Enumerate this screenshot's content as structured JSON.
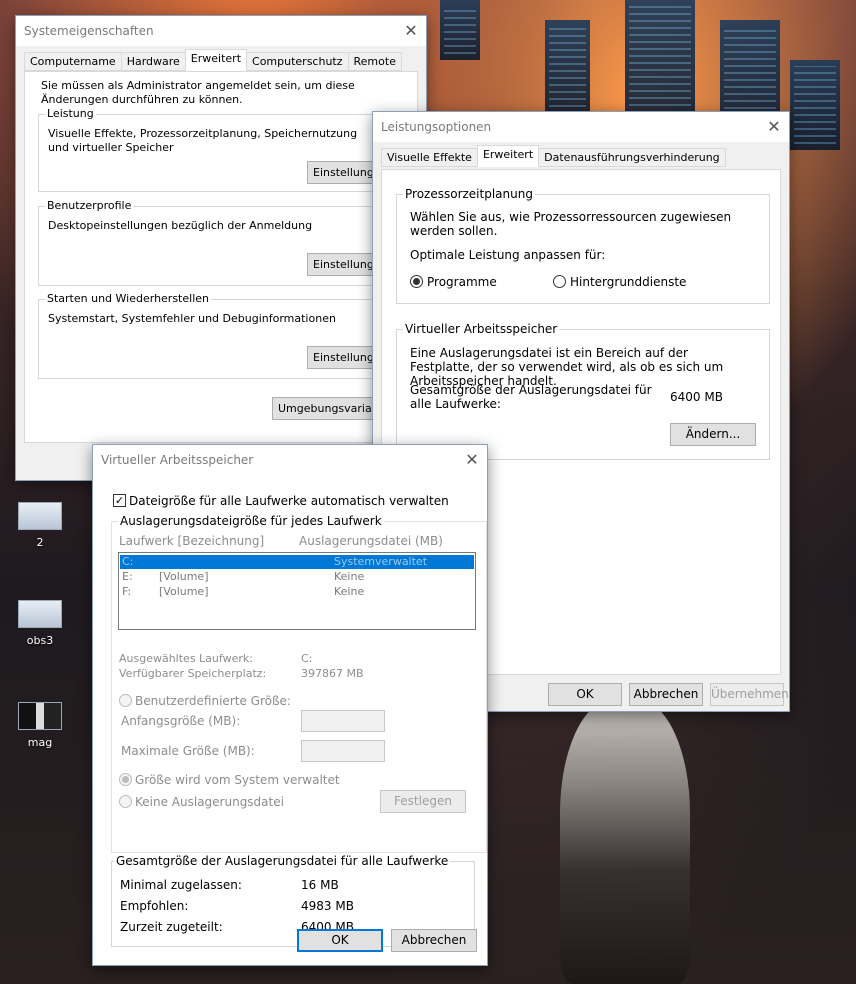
{
  "desktop": {
    "icons": [
      {
        "label": "2"
      },
      {
        "label": "obs3"
      },
      {
        "label": "mag"
      }
    ]
  },
  "sysprops": {
    "title": "Systemeigenschaften",
    "tabs": [
      "Computername",
      "Hardware",
      "Erweitert",
      "Computerschutz",
      "Remote"
    ],
    "admin_note": "Sie müssen als Administrator angemeldet sein, um diese Änderungen durchführen zu können.",
    "leistung": {
      "title": "Leistung",
      "desc": "Visuelle Effekte, Prozessorzeitplanung, Speichernutzung und virtueller Speicher",
      "button": "Einstellungen..."
    },
    "benutzerprofile": {
      "title": "Benutzerprofile",
      "desc": "Desktopeinstellungen bezüglich der Anmeldung",
      "button": "Einstellungen..."
    },
    "starten": {
      "title": "Starten und Wiederherstellen",
      "desc": "Systemstart, Systemfehler und Debuginformationen",
      "button": "Einstellungen..."
    },
    "env_button": "Umgebungsvariablen..."
  },
  "perfopts": {
    "title": "Leistungsoptionen",
    "tabs": [
      "Visuelle Effekte",
      "Erweitert",
      "Datenausführungsverhinderung"
    ],
    "proc": {
      "title": "Prozessorzeitplanung",
      "desc": "Wählen Sie aus, wie Prozessorressourcen zugewiesen werden sollen.",
      "adjust_label": "Optimale Leistung anpassen für:",
      "opt_programs": "Programme",
      "opt_services": "Hintergrunddienste"
    },
    "vm": {
      "title": "Virtueller Arbeitsspeicher",
      "desc": "Eine Auslagerungsdatei ist ein Bereich auf der Festplatte, der so verwendet wird, als ob es sich um Arbeitsspeicher handelt.",
      "total_label": "Gesamtgröße der Auslagerungsdatei für alle Laufwerke:",
      "total_value": "6400 MB",
      "change_button": "Ändern..."
    },
    "ok": "OK",
    "cancel": "Abbrechen",
    "apply": "Übernehmen"
  },
  "vmem": {
    "title": "Virtueller Arbeitsspeicher",
    "auto_label": "Dateigröße für alle Laufwerke automatisch verwalten",
    "per_drive_title": "Auslagerungsdateigröße für jedes Laufwerk",
    "col_drive": "Laufwerk [Bezeichnung]",
    "col_paging": "Auslagerungsdatei (MB)",
    "drives": [
      {
        "drive": "C:",
        "label": "",
        "paging": "Systemverwaltet"
      },
      {
        "drive": "E:",
        "label": "[Volume]",
        "paging": "Keine"
      },
      {
        "drive": "F:",
        "label": "[Volume]",
        "paging": "Keine"
      }
    ],
    "selected_label": "Ausgewähltes Laufwerk:",
    "selected_value": "C:",
    "free_label": "Verfügbarer Speicherplatz:",
    "free_value": "397867 MB",
    "custom_label": "Benutzerdefinierte Größe:",
    "initial_label": "Anfangsgröße (MB):",
    "max_label": "Maximale Größe (MB):",
    "system_label": "Größe wird vom System verwaltet",
    "none_label": "Keine Auslagerungsdatei",
    "set_button": "Festlegen",
    "total_title": "Gesamtgröße der Auslagerungsdatei für alle Laufwerke",
    "min_label": "Minimal zugelassen:",
    "min_value": "16 MB",
    "rec_label": "Empfohlen:",
    "rec_value": "4983 MB",
    "cur_label": "Zurzeit zugeteilt:",
    "cur_value": "6400 MB",
    "ok": "OK",
    "cancel": "Abbrechen"
  }
}
